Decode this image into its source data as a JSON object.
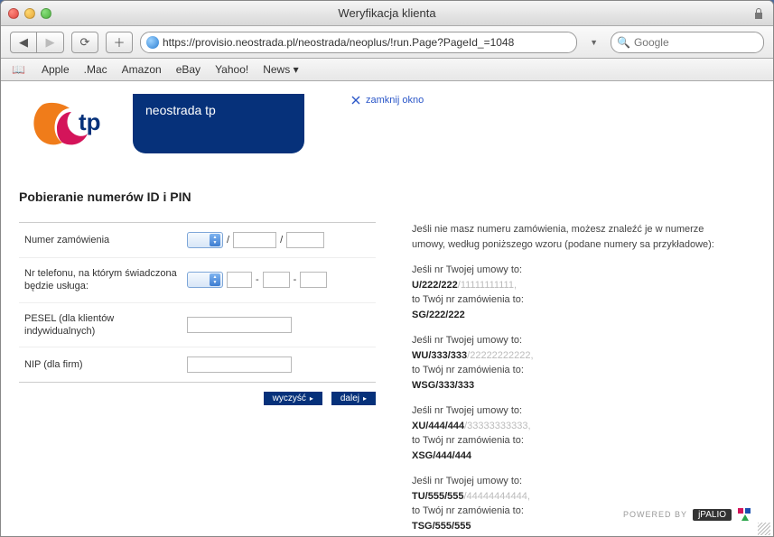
{
  "window": {
    "title": "Weryfikacja klienta"
  },
  "toolbar": {
    "url": "https://provisio.neostrada.pl/neostrada/neoplus/!run.Page?PageId_=1048",
    "search_placeholder": "Google"
  },
  "bookmarks": [
    "Apple",
    ".Mac",
    "Amazon",
    "eBay",
    "Yahoo!",
    "News"
  ],
  "brand": {
    "logo_text": "tp",
    "tab": "neostrada tp",
    "close": "zamknij okno"
  },
  "section_title": "Pobieranie numerów ID i PIN",
  "form": {
    "rows": {
      "order": {
        "label": "Numer zamówienia",
        "sep1": "/",
        "sep2": "/"
      },
      "phone": {
        "label": "Nr telefonu, na którym świadczona będzie usługa:",
        "sep": "-"
      },
      "pesel": {
        "label": "PESEL (dla klientów indywidualnych)"
      },
      "nip": {
        "label": "NIP (dla firm)"
      }
    },
    "buttons": {
      "clear": "wyczyść",
      "next": "dalej"
    }
  },
  "info": {
    "p0": "Jeśli nie masz numeru zamówienia, możesz znaleźć je w numerze umowy, według poniższego wzoru (podane numery sa przykładowe):",
    "g1": {
      "a": "Jeśli nr Twojej umowy to:",
      "b1": "U/222/222",
      "b2": "/11111111111,",
      "c": "to Twój nr zamówienia to:",
      "d": "SG/222/222"
    },
    "g2": {
      "a": "Jeśli nr Twojej umowy to:",
      "b1": "WU/333/333",
      "b2": "/22222222222,",
      "c": "to Twój nr zamówienia to:",
      "d": "WSG/333/333"
    },
    "g3": {
      "a": "Jeśli nr Twojej umowy to:",
      "b1": "XU/444/444",
      "b2": "/33333333333,",
      "c": "to Twój nr zamówienia to:",
      "d": "XSG/444/444"
    },
    "g4": {
      "a": "Jeśli nr Twojej umowy to:",
      "b1": "TU/555/555",
      "b2": "/44444444444,",
      "c": "to Twój nr zamówienia to:",
      "d": "TSG/555/555"
    }
  },
  "footer": {
    "powered": "POWERED BY",
    "jpalio": "jPALIO"
  }
}
